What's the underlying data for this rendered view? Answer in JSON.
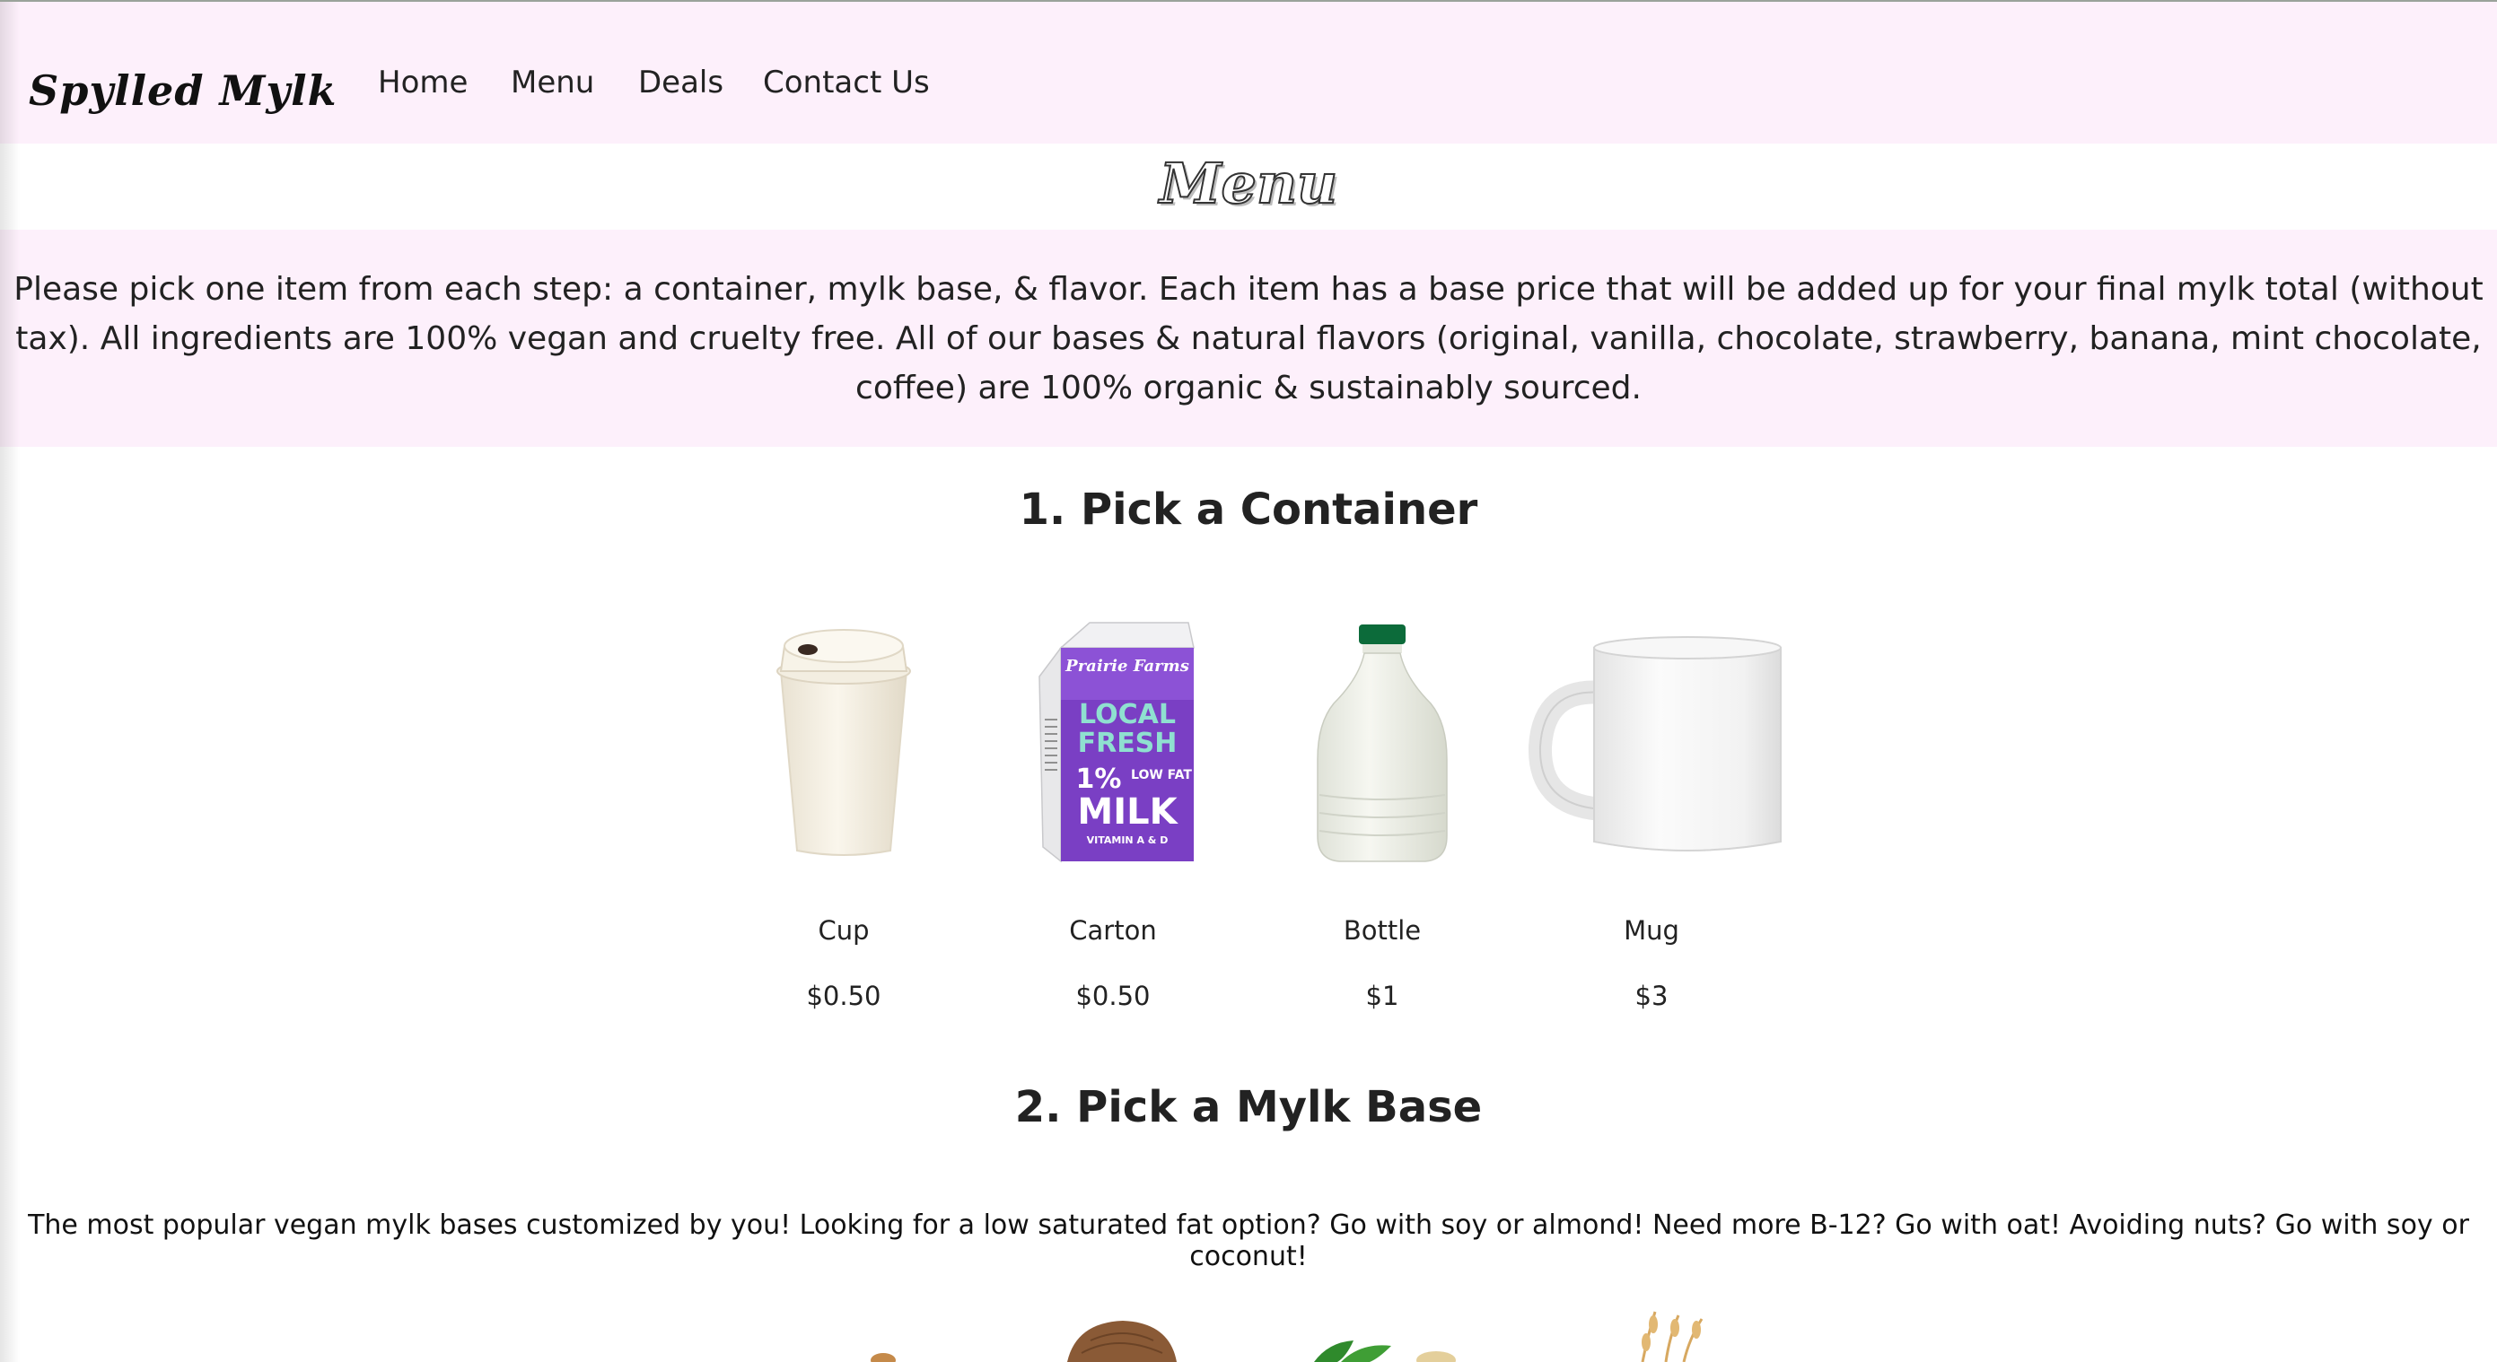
{
  "brand": {
    "name": "Spylled Mylk"
  },
  "nav": {
    "items": [
      {
        "label": "Home"
      },
      {
        "label": "Menu"
      },
      {
        "label": "Deals"
      },
      {
        "label": "Contact Us"
      }
    ]
  },
  "page": {
    "heading": "Menu",
    "intro": "Please pick one item from each step: a container, mylk base, & flavor. Each item has a base price that will be added up for your final mylk total (without tax). All ingredients are 100% vegan and cruelty free. All of our bases & natural flavors (original, vanilla, chocolate, strawberry, banana, mint chocolate, coffee) are 100% organic & sustainably sourced."
  },
  "step1": {
    "title": "1. Pick a Container",
    "items": [
      {
        "name": "Cup",
        "price": "$0.50",
        "icon": "cup-image"
      },
      {
        "name": "Carton",
        "price": "$0.50",
        "icon": "milk-carton-image",
        "carton_text": {
          "brand": "Prairie Farms",
          "line1": "LOCAL",
          "line2": "FRESH",
          "percent": "1%",
          "lowfat": "LOW FAT",
          "milk": "MILK",
          "vitamins": "VITAMIN A & D"
        }
      },
      {
        "name": "Bottle",
        "price": "$1",
        "icon": "milk-bottle-image"
      },
      {
        "name": "Mug",
        "price": "$3",
        "icon": "mug-image"
      }
    ]
  },
  "step2": {
    "title": "2. Pick a Mylk Base",
    "description": "The most popular vegan mylk bases customized by you! Looking for a low saturated fat option? Go with soy or almond! Need more B-12? Go with oat! Avoiding nuts? Go with soy or coconut!"
  },
  "colors": {
    "nav_bg": "#fdf0fb",
    "intro_bg": "#fdf0fb",
    "carton_purple": "#7a3fc4",
    "carton_mint": "#8fe0d0",
    "bottle_cap": "#0c6b3a"
  }
}
